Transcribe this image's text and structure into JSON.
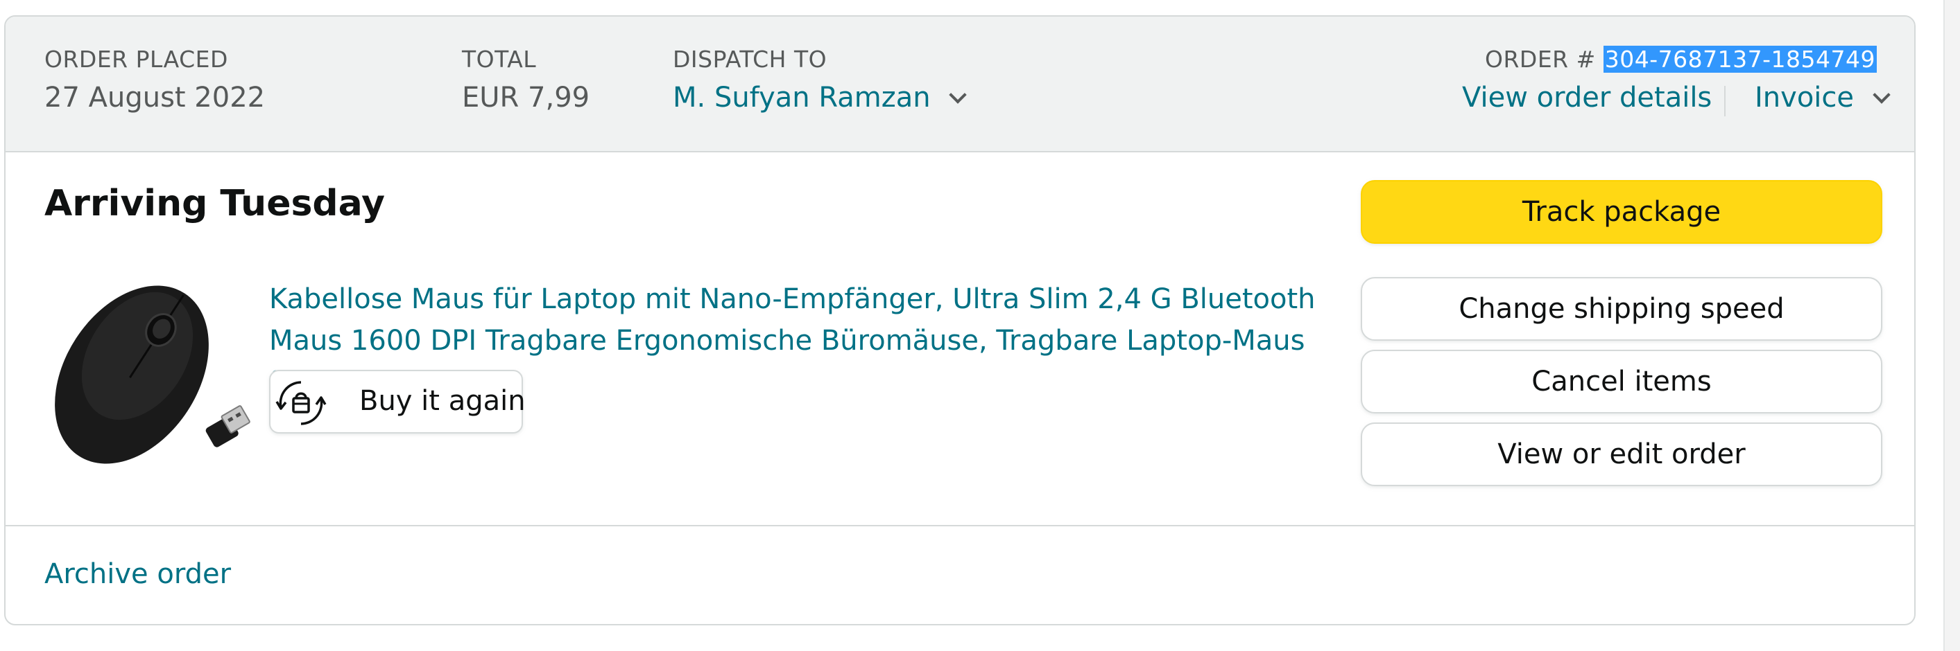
{
  "order_header": {
    "order_placed_label": "ORDER PLACED",
    "order_placed_value": "27 August 2022",
    "total_label": "TOTAL",
    "total_value": "EUR 7,99",
    "dispatch_to_label": "DISPATCH TO",
    "dispatch_to_value": "M. Sufyan Ramzan",
    "order_number_label": "ORDER #",
    "order_number_value": "304-7687137-1854749",
    "view_details_label": "View order details",
    "invoice_label": "Invoice"
  },
  "shipment": {
    "status_title": "Arriving Tuesday"
  },
  "product": {
    "image_icon": "wireless-mouse-image",
    "title": "Kabellose Maus für Laptop mit Nano-Empfänger, Ultra Slim 2,4 G Bluetooth Maus 1600 DPI Tragbare Ergonomische Büromäuse, Tragbare Laptop-Maus für",
    "buy_again_icon": "buy-again-icon",
    "buy_again_label": "Buy it again"
  },
  "actions": {
    "track_package": "Track package",
    "change_shipping_speed": "Change shipping speed",
    "cancel_items": "Cancel items",
    "view_or_edit_order": "View or edit order"
  },
  "footer": {
    "archive_label": "Archive order"
  },
  "colors": {
    "link": "#007185",
    "header_bg": "#f0f2f2",
    "primary_button": "#ffd814",
    "selection_highlight": "#3297fd",
    "border": "#d5d9d9"
  }
}
